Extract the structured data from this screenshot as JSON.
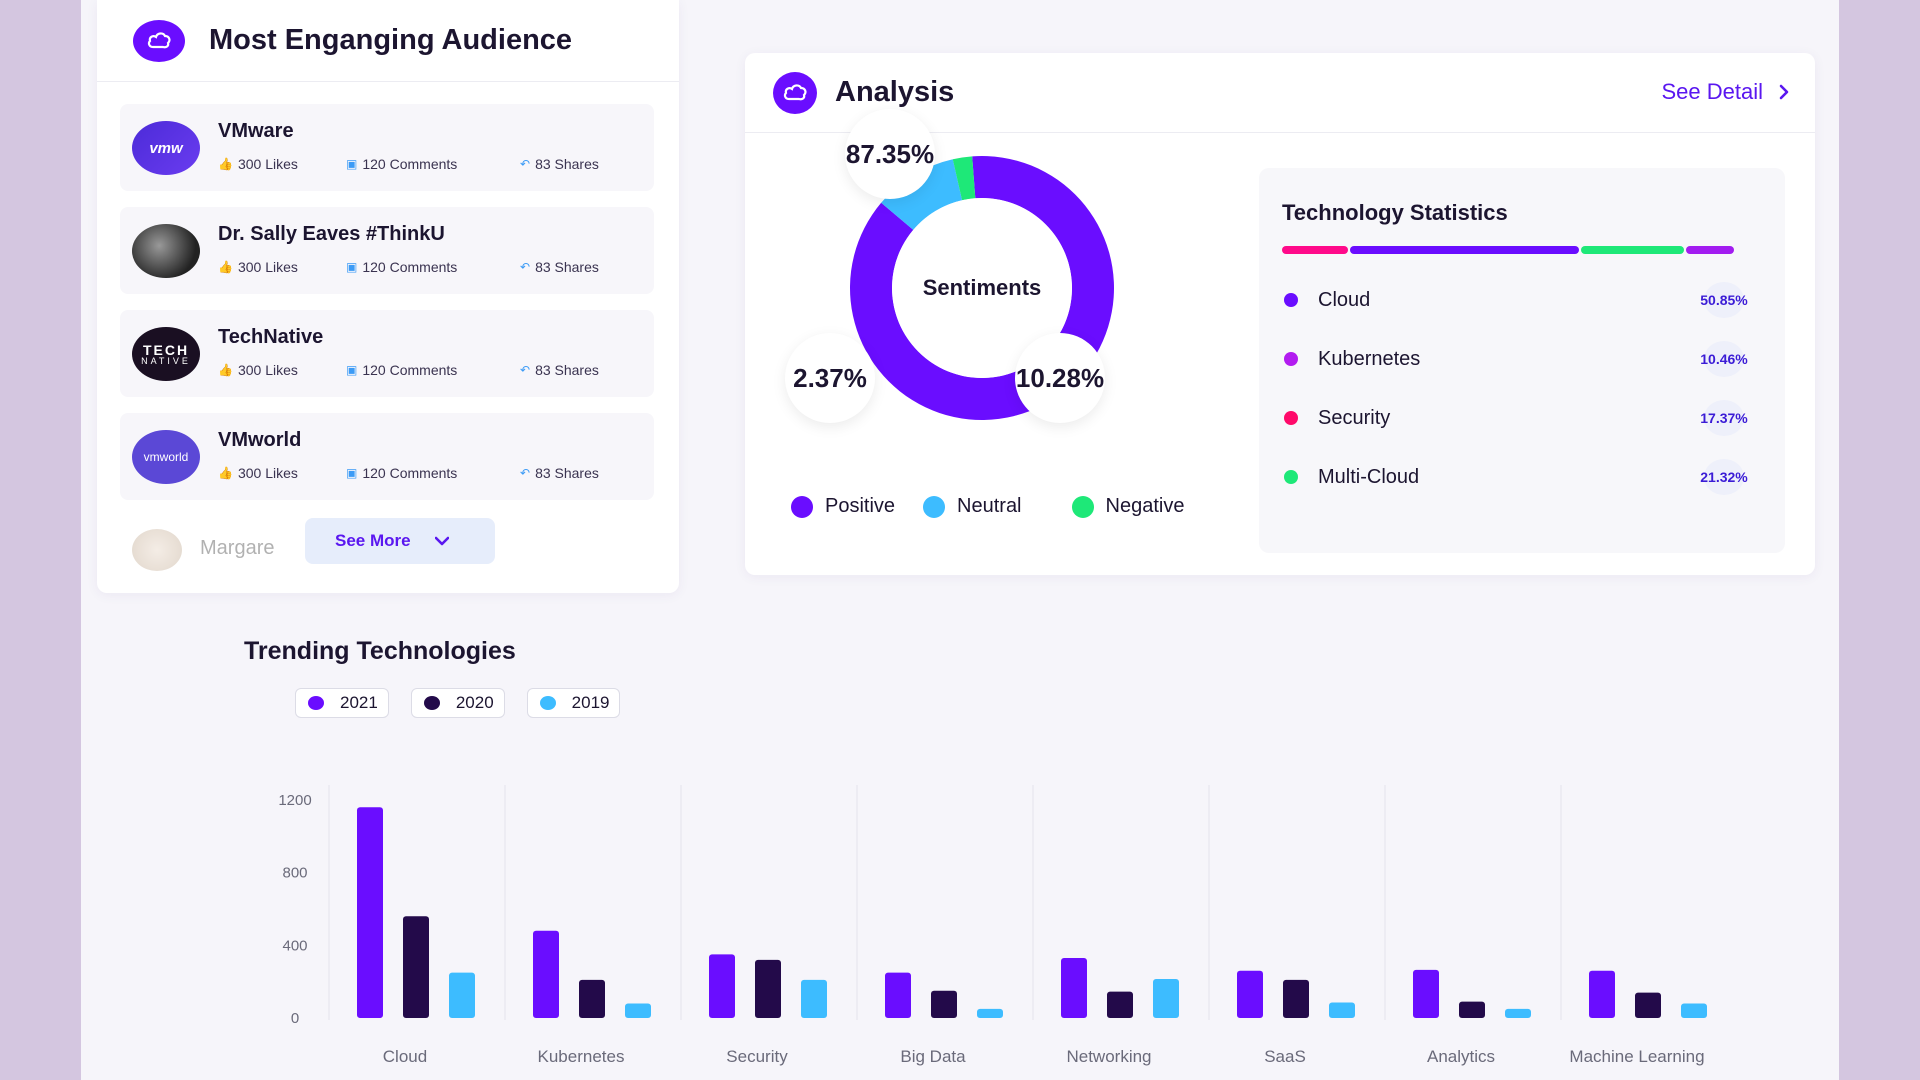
{
  "audience": {
    "title": "Most Enganging Audience",
    "items": [
      {
        "name": "VMware",
        "logo_text": "vmw",
        "likes": "300 Likes",
        "comments": "120 Comments",
        "shares": "83 Shares"
      },
      {
        "name": "Dr. Sally Eaves #ThinkU",
        "logo_text": "",
        "likes": "300 Likes",
        "comments": "120 Comments",
        "shares": "83 Shares"
      },
      {
        "name": "TechNative",
        "logo_text": "TECH",
        "logo_sub": "NATIVE",
        "likes": "300 Likes",
        "comments": "120 Comments",
        "shares": "83 Shares"
      },
      {
        "name": "VMworld",
        "logo_text": "vmworld",
        "likes": "300 Likes",
        "comments": "120 Comments",
        "shares": "83 Shares"
      }
    ],
    "faded_item": "Margare",
    "see_more": "See More"
  },
  "analysis": {
    "title": "Analysis",
    "see_detail": "See Detail",
    "sentiments": {
      "center_label": "Sentiments",
      "positive": "87.35%",
      "neutral": "10.28%",
      "negative": "2.37%",
      "legend": [
        {
          "label": "Positive",
          "color": "#6a0dff"
        },
        {
          "label": "Neutral",
          "color": "#3dbcff"
        },
        {
          "label": "Negative",
          "color": "#1ee878"
        }
      ]
    },
    "tech_stats": {
      "title": "Technology Statistics",
      "bar_colors": [
        "#ff0a8a",
        "#6a0dff",
        "#1ee878",
        "#a21cf0"
      ],
      "rows": [
        {
          "name": "Cloud",
          "pct": "50.85%",
          "color": "#6a0dff"
        },
        {
          "name": "Kubernetes",
          "pct": "10.46%",
          "color": "#b21cf0"
        },
        {
          "name": "Security",
          "pct": "17.37%",
          "color": "#ff0a6a"
        },
        {
          "name": "Multi-Cloud",
          "pct": "21.32%",
          "color": "#1ee878"
        }
      ]
    }
  },
  "trending": {
    "title": "Trending Technologies",
    "legend": [
      {
        "label": "2021",
        "color": "#6a0dff"
      },
      {
        "label": "2020",
        "color": "#230a4a"
      },
      {
        "label": "2019",
        "color": "#3dbcff"
      }
    ]
  },
  "chart_data": {
    "type": "bar",
    "title": "Trending Technologies",
    "categories": [
      "Cloud",
      "Kubernetes",
      "Security",
      "Big Data",
      "Networking",
      "SaaS",
      "Analytics",
      "Machine Learning"
    ],
    "series": [
      {
        "name": "2021",
        "color": "#6a0dff",
        "values": [
          1160,
          480,
          350,
          250,
          330,
          260,
          265,
          260
        ]
      },
      {
        "name": "2020",
        "color": "#230a4a",
        "values": [
          560,
          210,
          320,
          150,
          145,
          210,
          90,
          140
        ]
      },
      {
        "name": "2019",
        "color": "#3dbcff",
        "values": [
          250,
          80,
          210,
          50,
          215,
          85,
          50,
          80
        ]
      }
    ],
    "y_ticks": [
      "1200",
      "800",
      "400",
      "0"
    ],
    "ylim": [
      0,
      1200
    ],
    "grid": "vertical separators"
  }
}
